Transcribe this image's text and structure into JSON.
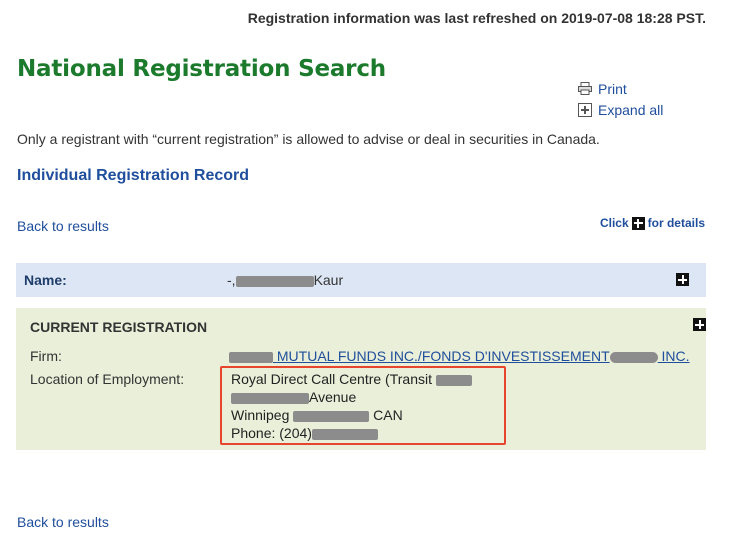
{
  "header": {
    "refresh_notice": "Registration information was last refreshed on 2019-07-08 18:28 PST."
  },
  "page": {
    "title": "National Registration Search",
    "notice": "Only a registrant with “current registration” is allowed to advise or deal in securities in Canada.",
    "record_title": "Individual Registration Record"
  },
  "tools": {
    "print_label": "Print",
    "expand_label": "Expand all",
    "print_icon": "printer-icon",
    "expand_icon": "expand-plus-icon"
  },
  "nav": {
    "back_label": "Back to results",
    "click_prefix": "Click",
    "click_suffix": "for details"
  },
  "name_row": {
    "label": "Name:",
    "value_prefix": "-,",
    "value_suffix": "Kaur"
  },
  "registration": {
    "heading": "CURRENT REGISTRATION",
    "firm_label": "Firm:",
    "firm_value_part1": "MUTUAL FUNDS INC./FONDS D'INVESTISSEMENT",
    "firm_value_part2": "INC.",
    "location_label": "Location of Employment:",
    "address": {
      "line1": "Royal Direct Call Centre (Transit",
      "line2_suffix": "Avenue",
      "line3_prefix": "Winnipeg",
      "line3_suffix": "CAN",
      "line4_prefix": "Phone: (204)"
    }
  },
  "colors": {
    "title_green": "#1b7a2c",
    "link_blue": "#1f4e9c",
    "name_bar": "#dde6f4",
    "registration_panel": "#e9efd9",
    "highlight_border": "#e8452e"
  }
}
